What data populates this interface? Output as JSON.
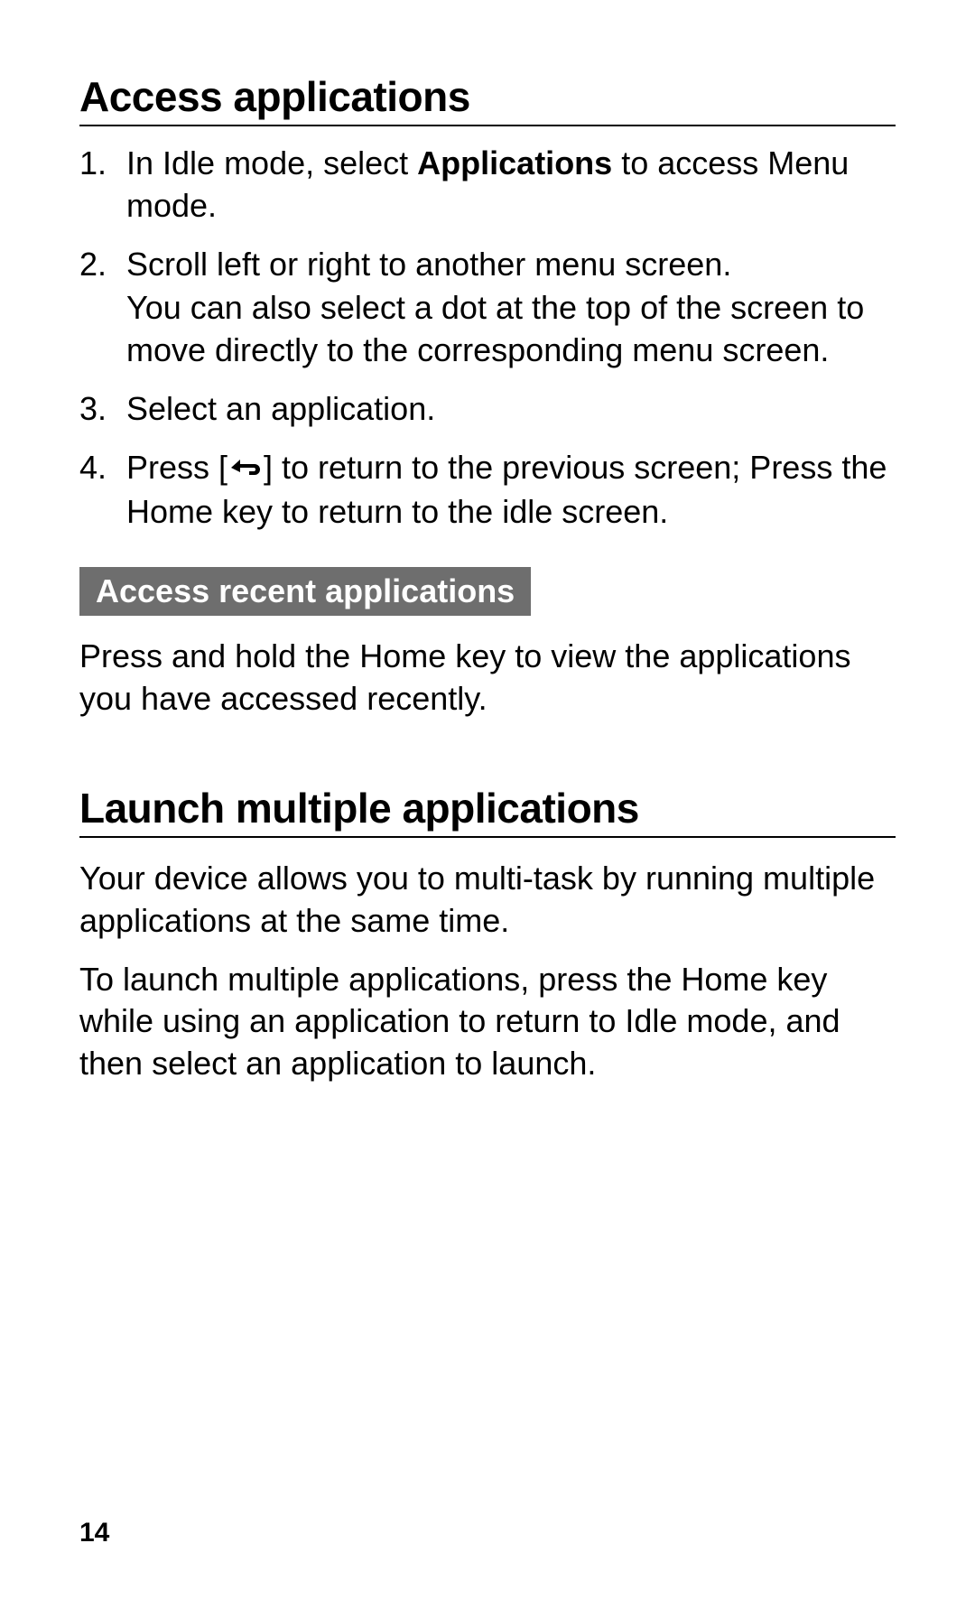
{
  "section1": {
    "heading": "Access applications",
    "steps": {
      "s1_pre": "In Idle mode, select ",
      "s1_bold": "Applications",
      "s1_post": " to access Menu mode.",
      "s2_line1": "Scroll left or right to another menu screen.",
      "s2_line2": "You can also select a dot at the top of the screen to move directly to the corresponding menu screen.",
      "s3": "Select an application.",
      "s4_pre": "Press [",
      "s4_post": "] to return to the previous screen; Press the Home key to return to the idle screen."
    },
    "callout_title": "Access recent applications",
    "callout_body": "Press and hold the Home key to view the applications you have accessed recently."
  },
  "section2": {
    "heading": "Launch multiple applications",
    "p1": "Your device allows you to multi-task by running multiple applications at the same time.",
    "p2": "To launch multiple applications, press the Home key while using an application to return to Idle mode, and then select an application to launch."
  },
  "page_number": "14"
}
